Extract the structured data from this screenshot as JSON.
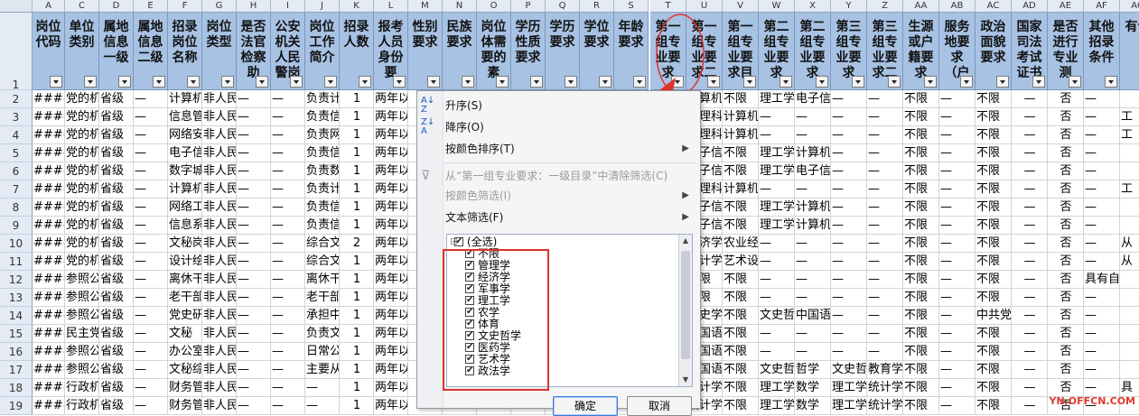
{
  "columns": [
    {
      "letter": "A",
      "header": "岗位代码"
    },
    {
      "letter": "C",
      "header": "单位类别"
    },
    {
      "letter": "D",
      "header": "属地信息一级"
    },
    {
      "letter": "E",
      "header": "属地信息二级"
    },
    {
      "letter": "F",
      "header": "招录岗位名称"
    },
    {
      "letter": "G",
      "header": "岗位类型"
    },
    {
      "letter": "H",
      "header": "是否法官检察助"
    },
    {
      "letter": "I",
      "header": "公安机关人民警岗"
    },
    {
      "letter": "J",
      "header": "岗位工作简介"
    },
    {
      "letter": "K",
      "header": "招录人数"
    },
    {
      "letter": "L",
      "header": "报考人员身份要"
    },
    {
      "letter": "M",
      "header": "性别要求"
    },
    {
      "letter": "N",
      "header": "民族要求"
    },
    {
      "letter": "O",
      "header": "岗位体需要的素"
    },
    {
      "letter": "P",
      "header": "学历性质要求"
    },
    {
      "letter": "Q",
      "header": "学历要求"
    },
    {
      "letter": "R",
      "header": "学位要求"
    },
    {
      "letter": "S",
      "header": "年龄要求"
    },
    {
      "letter": "T",
      "header": "第一组专业要求"
    },
    {
      "letter": "U",
      "header": "第一组专业要求二"
    },
    {
      "letter": "V",
      "header": "第一组专业要求目"
    },
    {
      "letter": "W",
      "header": "第二组专业要求"
    },
    {
      "letter": "X",
      "header": "第二组专业要求"
    },
    {
      "letter": "Y",
      "header": "第三组专业要求"
    },
    {
      "letter": "Z",
      "header": "第三组专业要求二"
    },
    {
      "letter": "AA",
      "header": "生源或户籍要求"
    },
    {
      "letter": "AB",
      "header": "服务地要求（户"
    },
    {
      "letter": "AC",
      "header": "政治面貌要求"
    },
    {
      "letter": "AD",
      "header": "国家司法考试证书"
    },
    {
      "letter": "AE",
      "header": "是否进行专业测"
    },
    {
      "letter": "AF",
      "header": "其他招录条件"
    },
    {
      "letter": "AG",
      "header": "有说"
    }
  ],
  "row_numbers": [
    "1",
    "2",
    "3",
    "4",
    "5",
    "6",
    "7",
    "8",
    "9",
    "10",
    "11",
    "12",
    "13",
    "14",
    "15",
    "16",
    "17",
    "18",
    "19"
  ],
  "rows": [
    [
      "####",
      "党的机",
      "省级",
      "—",
      "计算机",
      "非人民",
      "—",
      "—",
      "负责计",
      "1",
      "两年以",
      "",
      "",
      "",
      "",
      "",
      "",
      "",
      "",
      "计算机",
      "不限",
      "理工学",
      "电子信",
      "—",
      "—",
      "不限",
      "—",
      "不限",
      "—",
      "否",
      "—",
      ""
    ],
    [
      "####",
      "党的机",
      "省级",
      "—",
      "信息管",
      "非人民",
      "—",
      "—",
      "负责信",
      "1",
      "两年以",
      "",
      "",
      "",
      "",
      "",
      "",
      "",
      "",
      "管理科",
      "计算机",
      "—",
      "—",
      "—",
      "—",
      "不限",
      "—",
      "不限",
      "—",
      "否",
      "—",
      "工"
    ],
    [
      "####",
      "党的机",
      "省级",
      "—",
      "网络安",
      "非人民",
      "—",
      "—",
      "负责网",
      "1",
      "两年以",
      "",
      "",
      "",
      "",
      "",
      "",
      "",
      "",
      "管理科",
      "计算机",
      "—",
      "—",
      "—",
      "—",
      "不限",
      "—",
      "不限",
      "—",
      "否",
      "—",
      "工"
    ],
    [
      "####",
      "党的机",
      "省级",
      "—",
      "电子信",
      "非人民",
      "—",
      "—",
      "负责信",
      "1",
      "两年以",
      "",
      "",
      "",
      "",
      "",
      "",
      "",
      "",
      "电子信",
      "不限",
      "理工学",
      "计算机",
      "—",
      "—",
      "不限",
      "—",
      "不限",
      "—",
      "否",
      "—",
      ""
    ],
    [
      "####",
      "党的机",
      "省级",
      "—",
      "数字城",
      "非人民",
      "—",
      "—",
      "负责数",
      "1",
      "两年以",
      "",
      "",
      "",
      "",
      "",
      "",
      "",
      "",
      "电子信",
      "不限",
      "理工学",
      "电子信",
      "—",
      "—",
      "不限",
      "—",
      "不限",
      "—",
      "否",
      "—",
      ""
    ],
    [
      "####",
      "党的机",
      "省级",
      "—",
      "计算机",
      "非人民",
      "—",
      "—",
      "负责计",
      "1",
      "两年以",
      "",
      "",
      "",
      "",
      "",
      "",
      "",
      "",
      "管理科",
      "计算机",
      "—",
      "—",
      "—",
      "—",
      "不限",
      "—",
      "不限",
      "—",
      "否",
      "—",
      "工"
    ],
    [
      "####",
      "党的机",
      "省级",
      "—",
      "网络工",
      "非人民",
      "—",
      "—",
      "负责信",
      "1",
      "两年以",
      "",
      "",
      "",
      "",
      "",
      "",
      "",
      "",
      "电子信",
      "不限",
      "理工学",
      "计算机",
      "—",
      "—",
      "不限",
      "—",
      "不限",
      "—",
      "否",
      "—",
      ""
    ],
    [
      "####",
      "党的机",
      "省级",
      "—",
      "信息系",
      "非人民",
      "—",
      "—",
      "负责信",
      "1",
      "两年以",
      "",
      "",
      "",
      "",
      "",
      "",
      "",
      "",
      "电子信",
      "不限",
      "理工学",
      "计算机",
      "—",
      "—",
      "不限",
      "—",
      "不限",
      "—",
      "否",
      "—",
      ""
    ],
    [
      "####",
      "党的机",
      "省级",
      "—",
      "文秘岗",
      "非人民",
      "—",
      "—",
      "综合文",
      "2",
      "两年以",
      "",
      "",
      "",
      "",
      "",
      "",
      "",
      "",
      "经济学",
      "农业经",
      "—",
      "—",
      "—",
      "—",
      "不限",
      "—",
      "不限",
      "—",
      "否",
      "—",
      "从"
    ],
    [
      "####",
      "党的机",
      "省级",
      "—",
      "设计绘",
      "非人民",
      "—",
      "—",
      "综合文",
      "1",
      "两年以",
      "",
      "",
      "",
      "",
      "",
      "",
      "",
      "",
      "设计学",
      "艺术设",
      "—",
      "—",
      "—",
      "—",
      "不限",
      "—",
      "不限",
      "—",
      "否",
      "—",
      "从"
    ],
    [
      "####",
      "参照公",
      "省级",
      "—",
      "离休干",
      "非人民",
      "—",
      "—",
      "离休干",
      "1",
      "两年以",
      "",
      "",
      "",
      "",
      "",
      "",
      "",
      "",
      "不限",
      "不限",
      "—",
      "—",
      "—",
      "—",
      "不限",
      "—",
      "不限",
      "—",
      "否",
      "具有自",
      ""
    ],
    [
      "####",
      "参照公",
      "省级",
      "—",
      "老干部",
      "非人民",
      "—",
      "—",
      "老干部",
      "1",
      "两年以",
      "",
      "",
      "",
      "",
      "",
      "",
      "",
      "",
      "不限",
      "不限",
      "—",
      "—",
      "—",
      "—",
      "不限",
      "—",
      "不限",
      "—",
      "否",
      "—",
      ""
    ],
    [
      "####",
      "参照公",
      "省级",
      "—",
      "党史研",
      "非人民",
      "—",
      "—",
      "承担中",
      "1",
      "两年以",
      "",
      "",
      "",
      "",
      "",
      "",
      "",
      "",
      "历史学",
      "不限",
      "文史哲",
      "中国语",
      "—",
      "—",
      "不限",
      "—",
      "中共党",
      "—",
      "否",
      "—",
      ""
    ],
    [
      "####",
      "民主党",
      "省级",
      "—",
      "文秘",
      "非人民",
      "—",
      "—",
      "负责文",
      "1",
      "两年以",
      "",
      "",
      "",
      "",
      "",
      "",
      "",
      "",
      "中国语",
      "不限",
      "—",
      "—",
      "—",
      "—",
      "不限",
      "—",
      "不限",
      "—",
      "否",
      "—",
      ""
    ],
    [
      "####",
      "参照公",
      "省级",
      "—",
      "办公室",
      "非人民",
      "—",
      "—",
      "日常公",
      "1",
      "两年以",
      "",
      "",
      "",
      "",
      "",
      "",
      "",
      "",
      "中国语",
      "不限",
      "—",
      "—",
      "—",
      "—",
      "不限",
      "—",
      "不限",
      "—",
      "否",
      "—",
      ""
    ],
    [
      "####",
      "参照公",
      "省级",
      "—",
      "文秘综",
      "非人民",
      "—",
      "—",
      "主要从",
      "1",
      "两年以",
      "",
      "",
      "",
      "",
      "",
      "",
      "",
      "",
      "中国语",
      "不限",
      "文史哲",
      "哲学",
      "文史哲",
      "教育学",
      "不限",
      "—",
      "不限",
      "—",
      "否",
      "—",
      ""
    ],
    [
      "####",
      "行政机",
      "省级",
      "—",
      "财务管",
      "非人民",
      "—",
      "—",
      "—",
      "1",
      "两年以",
      "",
      "",
      "",
      "",
      "",
      "",
      "",
      "",
      "会计学",
      "不限",
      "理工学",
      "数学",
      "理工学",
      "统计学",
      "不限",
      "—",
      "不限",
      "—",
      "否",
      "—",
      "具"
    ],
    [
      "####",
      "行政机",
      "省级",
      "—",
      "财务管",
      "非人民",
      "—",
      "—",
      "—",
      "1",
      "两年以",
      "",
      "",
      "",
      "",
      "",
      "",
      "",
      "",
      "会计学",
      "不限",
      "理工学",
      "数学",
      "理工学",
      "统计学",
      "不限",
      "—",
      "不限",
      "—",
      "否",
      "—",
      ""
    ]
  ],
  "filter_menu": {
    "sort_asc": "升序(S)",
    "sort_desc": "降序(O)",
    "sort_by_color": "按颜色排序(T)",
    "clear_filter": "从“第一组专业要求：一级目录”中清除筛选(C)",
    "filter_by_color": "按颜色筛选(I)",
    "text_filter": "文本筛选(F)",
    "list_items": [
      "(全选)",
      "不限",
      "管理学",
      "经济学",
      "军事学",
      "理工学",
      "农学",
      "体育",
      "文史哲学",
      "医药学",
      "艺术学",
      "政法学"
    ],
    "ok_label": "确定",
    "cancel_label": "取消"
  },
  "watermark": "YN.OFFCN.COM",
  "colors": {
    "header_fill": "#a8c2e4",
    "annotation_red": "#e0312f"
  }
}
